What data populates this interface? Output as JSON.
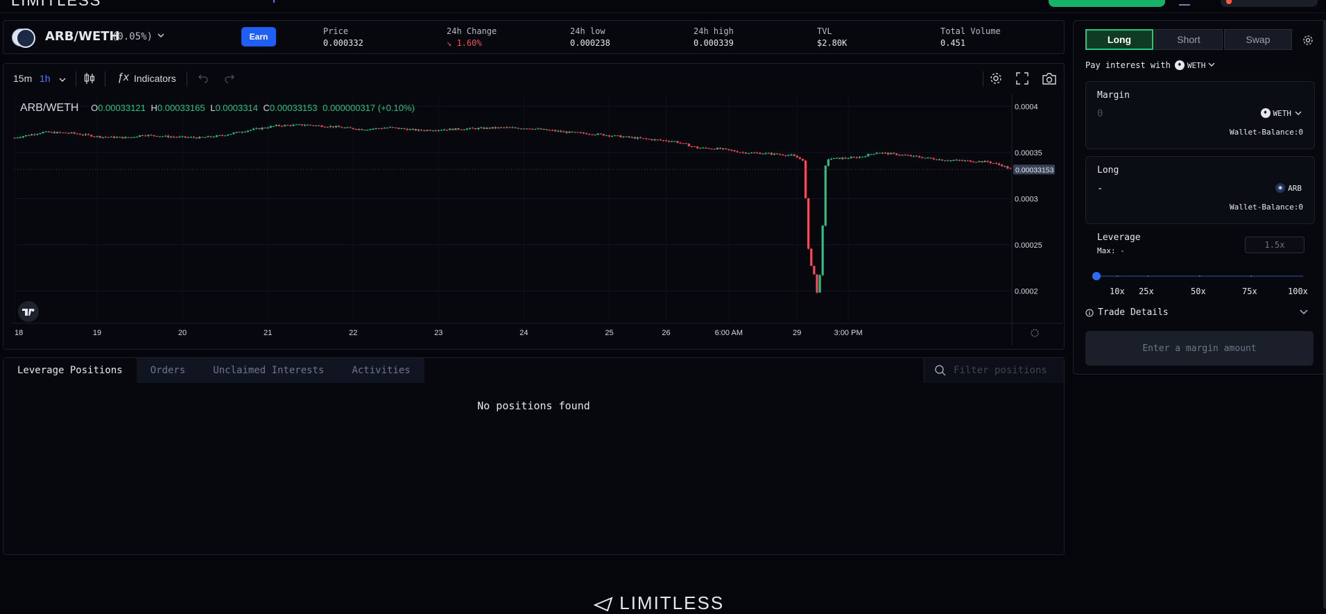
{
  "brand": {
    "name": "LIMITLESS"
  },
  "pair": {
    "name": "ARB/WETH",
    "fee": "(0.05%)",
    "earn_label": "Earn",
    "stats": [
      {
        "label": "Price",
        "value": "0.000332",
        "trend": ""
      },
      {
        "label": "24h Change",
        "value": "↘ 1.60%",
        "trend": "down"
      },
      {
        "label": "24h low",
        "value": "0.000238",
        "trend": ""
      },
      {
        "label": "24h high",
        "value": "0.000339",
        "trend": ""
      },
      {
        "label": "TVL",
        "value": "$2.80K",
        "trend": ""
      },
      {
        "label": "Total Volume",
        "value": "0.451",
        "trend": ""
      }
    ]
  },
  "toolbar": {
    "intervals": [
      "15m",
      "1h"
    ],
    "active_interval": "1h",
    "indicators_label": "Indicators"
  },
  "chart_data": {
    "type": "candlestick",
    "symbol": "ARB/WETH",
    "ohlc_legend": {
      "open_label": "O",
      "open": "0.00033121",
      "high_label": "H",
      "high": "0.00033165",
      "low_label": "L",
      "low": "0.0003314",
      "close_label": "C",
      "close": "0.00033153",
      "change": "0.000000317 (+0.10%)"
    },
    "y_ticks": [
      "0.0004",
      "0.00035",
      "0.0003",
      "0.00025",
      "0.0002"
    ],
    "y_values": [
      0.0004,
      0.00035,
      0.0003,
      0.00025,
      0.0002
    ],
    "x_ticks": [
      "18",
      "19",
      "20",
      "21",
      "22",
      "23",
      "24",
      "25",
      "26",
      "6:00 AM",
      "29",
      "3:00 PM"
    ],
    "ylim": [
      0.000165,
      0.000413
    ],
    "last_price_label": "0.00033153",
    "last_price": 0.00033153,
    "close_keypoints": [
      [
        0,
        0.000366
      ],
      [
        10,
        0.000372
      ],
      [
        20,
        0.000371
      ],
      [
        30,
        0.000367
      ],
      [
        40,
        0.000366
      ],
      [
        45,
        0.000369
      ],
      [
        55,
        0.000367
      ],
      [
        65,
        0.000366
      ],
      [
        72,
        0.000368
      ],
      [
        82,
        0.000374
      ],
      [
        92,
        0.000379
      ],
      [
        102,
        0.00038
      ],
      [
        112,
        0.000378
      ],
      [
        122,
        0.000375
      ],
      [
        132,
        0.000377
      ],
      [
        142,
        0.000374
      ],
      [
        152,
        0.000375
      ],
      [
        162,
        0.000376
      ],
      [
        172,
        0.000377
      ],
      [
        182,
        0.000376
      ],
      [
        194,
        0.000372
      ],
      [
        204,
        0.00037
      ],
      [
        214,
        0.000367
      ],
      [
        224,
        0.000364
      ],
      [
        232,
        0.000362
      ],
      [
        240,
        0.000355
      ],
      [
        248,
        0.000354
      ],
      [
        256,
        0.00035
      ],
      [
        264,
        0.000349
      ],
      [
        273,
        0.000347
      ],
      [
        277,
        0.000342
      ],
      [
        278,
        0.0003
      ],
      [
        279,
        0.000245
      ],
      [
        280,
        0.000228
      ],
      [
        281,
        0.000218
      ],
      [
        282,
        0.000198
      ],
      [
        283,
        0.000218
      ],
      [
        284,
        0.00027
      ],
      [
        285,
        0.000335
      ],
      [
        286,
        0.000343
      ],
      [
        292,
        0.000344
      ],
      [
        297,
        0.000345
      ],
      [
        303,
        0.00035
      ],
      [
        310,
        0.000348
      ],
      [
        318,
        0.000345
      ],
      [
        326,
        0.000342
      ],
      [
        334,
        0.000341
      ],
      [
        342,
        0.00034
      ],
      [
        347,
        0.000336
      ],
      [
        350,
        0.000332
      ]
    ]
  },
  "positions": {
    "tabs": [
      "Leverage Positions",
      "Orders",
      "Unclaimed Interests",
      "Activities"
    ],
    "active_tab": "Leverage Positions",
    "filter_placeholder": "Filter positions",
    "empty_text": "No positions found"
  },
  "trade": {
    "sides": [
      "Long",
      "Short",
      "Swap"
    ],
    "active_side": "Long",
    "pay_interest_label": "Pay interest with",
    "pay_token": "WETH",
    "margin": {
      "title": "Margin",
      "amount_placeholder": "0",
      "token": "WETH",
      "wallet_label": "Wallet-Balance:",
      "wallet_value": "0"
    },
    "long": {
      "title": "Long",
      "amount": "-",
      "token": "ARB",
      "wallet_label": "Wallet-Balance:",
      "wallet_value": "0"
    },
    "leverage": {
      "title": "Leverage",
      "max_label": "Max:",
      "max_value": "-",
      "input_placeholder": "1.5x",
      "level_fraction": 0,
      "marks": [
        "10x",
        "25x",
        "50x",
        "75x",
        "100x"
      ]
    },
    "details_label": "Trade Details",
    "submit_label": "Enter a margin amount"
  },
  "colors": {
    "up": "#26c281",
    "down": "#f04e5e",
    "accent": "#1e5ff7",
    "long_active": "#25c780"
  }
}
